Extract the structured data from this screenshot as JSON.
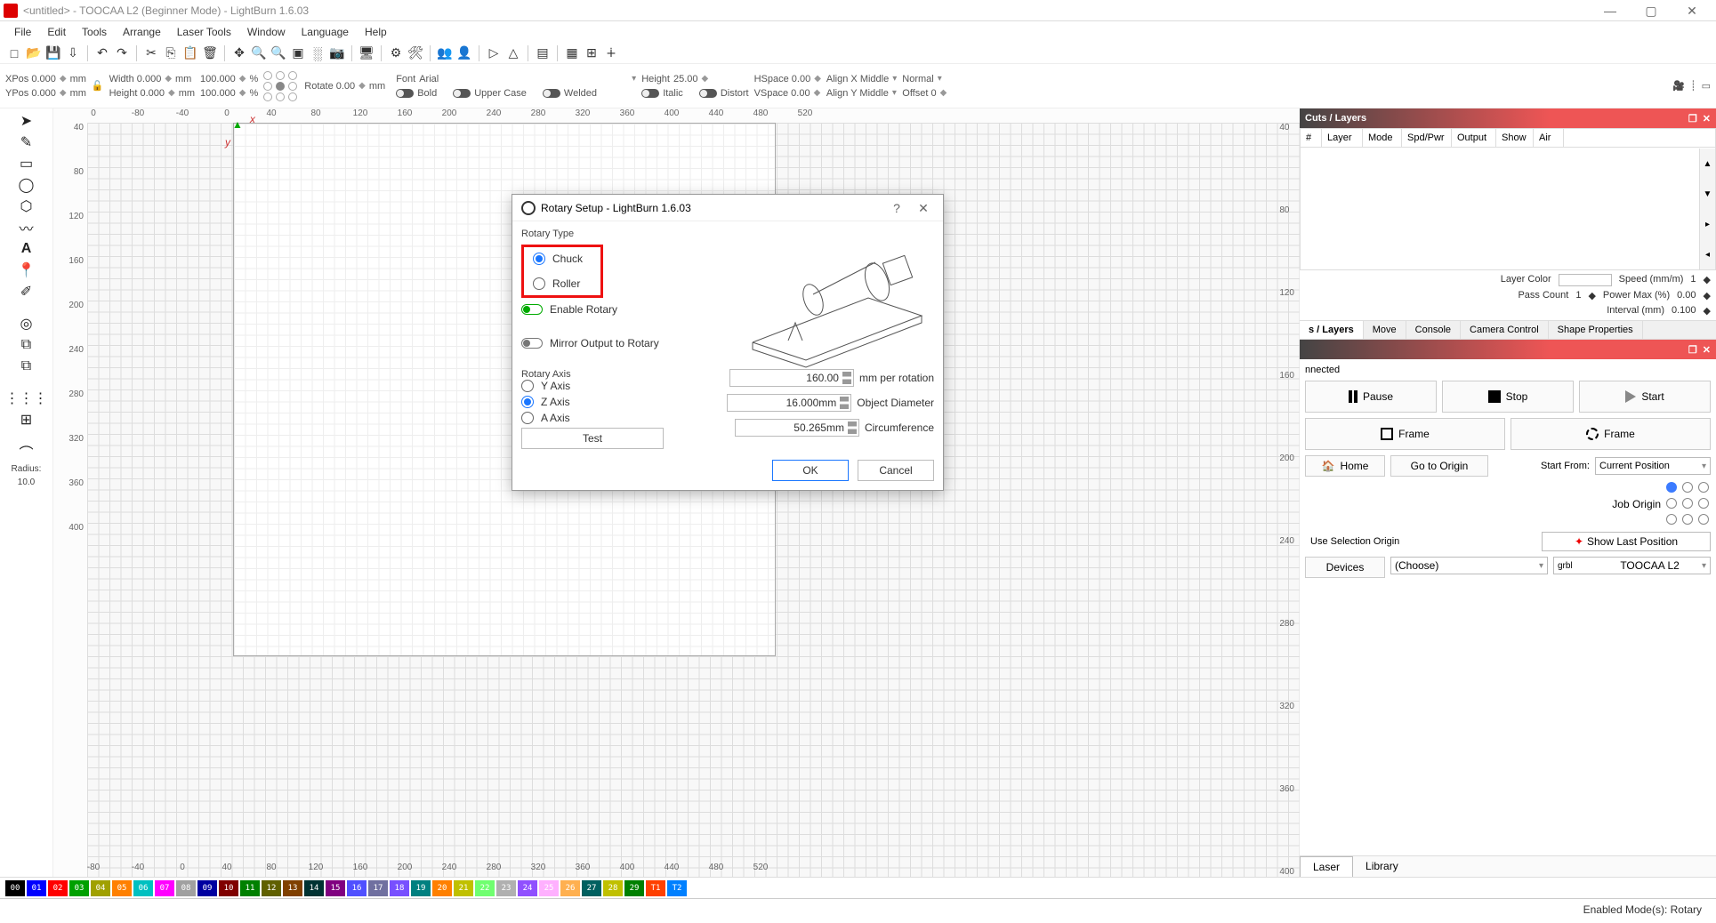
{
  "window": {
    "title": "<untitled> - TOOCAA L2 (Beginner Mode) - LightBurn 1.6.03",
    "min_icon": "—",
    "max_icon": "▢",
    "close_icon": "✕"
  },
  "menubar": [
    "File",
    "Edit",
    "Tools",
    "Arrange",
    "Laser Tools",
    "Window",
    "Language",
    "Help"
  ],
  "props": {
    "xpos": "XPos 0.000",
    "ypos": "YPos 0.000",
    "mm1": "mm",
    "width": "Width 0.000",
    "height": "Height 0.000",
    "mm2": "mm",
    "w100": "100.000",
    "h100": "100.000",
    "pct": "%",
    "rotate": "Rotate 0.00",
    "mm3": "mm",
    "font_label": "Font",
    "font_value": "Arial",
    "height_label": "Height",
    "height_value": "25.00",
    "bold": "Bold",
    "italic": "Italic",
    "upper": "Upper Case",
    "distort": "Distort",
    "welded": "Welded",
    "hspace": "HSpace 0.00",
    "vspace": "VSpace 0.00",
    "alignx": "Align X Middle",
    "aligny": "Align Y Middle",
    "normal": "Normal",
    "offset": "Offset 0"
  },
  "left_tools_radius_label": "Radius:",
  "left_tools_radius_value": "10.0",
  "ruler_top": [
    "0",
    "-80",
    "-40",
    "0",
    "40",
    "80",
    "120",
    "160",
    "200",
    "240",
    "280",
    "320",
    "360",
    "400",
    "440",
    "480",
    "520"
  ],
  "ruler_left": [
    "40",
    "80",
    "120",
    "160",
    "200",
    "240",
    "280",
    "320",
    "360",
    "400"
  ],
  "ruler_bottom": [
    "-80",
    "-40",
    "0",
    "40",
    "80",
    "120",
    "160",
    "200",
    "240",
    "280",
    "320",
    "360",
    "400",
    "440",
    "480",
    "520"
  ],
  "ruler_right": [
    "40",
    "80",
    "120",
    "160",
    "200",
    "240",
    "280",
    "320",
    "360",
    "400"
  ],
  "cuts_panel": {
    "title": "Cuts / Layers",
    "cols": [
      "#",
      "Layer",
      "Mode",
      "Spd/Pwr",
      "Output",
      "Show",
      "Air"
    ],
    "layer_color": "Layer Color",
    "speed_label": "Speed (mm/m)",
    "speed_value": "1",
    "pass_count_label": "Pass Count",
    "pass_count_value": "1",
    "power_label": "Power Max (%)",
    "power_value": "0.00",
    "interval_label": "Interval (mm)",
    "interval_value": "0.100"
  },
  "tabs_row": [
    "s / Layers",
    "Move",
    "Console",
    "Camera Control",
    "Shape Properties"
  ],
  "laser_panel": {
    "connected": "nnected",
    "pause": "Pause",
    "stop": "Stop",
    "start": "Start",
    "frame1": "Frame",
    "frame2": "Frame",
    "home": "Home",
    "go_origin": "Go to Origin",
    "start_from": "Start From:",
    "start_from_value": "Current Position",
    "job_origin": "Job Origin",
    "use_sel_origin": "Use Selection Origin",
    "show_last": "Show Last Position",
    "devices": "Devices",
    "choose": "(Choose)",
    "dev_name": "TOOCAA L2"
  },
  "lib_tabs": [
    "Laser",
    "Library"
  ],
  "color_swatches": [
    {
      "lbl": "00",
      "bg": "#000000"
    },
    {
      "lbl": "01",
      "bg": "#0000ff"
    },
    {
      "lbl": "02",
      "bg": "#ff0000"
    },
    {
      "lbl": "03",
      "bg": "#00a000"
    },
    {
      "lbl": "04",
      "bg": "#a0a000"
    },
    {
      "lbl": "05",
      "bg": "#ff8000"
    },
    {
      "lbl": "06",
      "bg": "#00c0c0"
    },
    {
      "lbl": "07",
      "bg": "#ff00ff"
    },
    {
      "lbl": "08",
      "bg": "#a0a0a0"
    },
    {
      "lbl": "09",
      "bg": "#0000a0"
    },
    {
      "lbl": "10",
      "bg": "#800000"
    },
    {
      "lbl": "11",
      "bg": "#008000"
    },
    {
      "lbl": "12",
      "bg": "#606000"
    },
    {
      "lbl": "13",
      "bg": "#804000"
    },
    {
      "lbl": "14",
      "bg": "#003232"
    },
    {
      "lbl": "15",
      "bg": "#800080"
    },
    {
      "lbl": "16",
      "bg": "#5050ff"
    },
    {
      "lbl": "17",
      "bg": "#7070a0"
    },
    {
      "lbl": "18",
      "bg": "#7850ff"
    },
    {
      "lbl": "19",
      "bg": "#008080"
    },
    {
      "lbl": "20",
      "bg": "#ff8000"
    },
    {
      "lbl": "21",
      "bg": "#c0c000"
    },
    {
      "lbl": "22",
      "bg": "#70ff70"
    },
    {
      "lbl": "23",
      "bg": "#b0b0b0"
    },
    {
      "lbl": "24",
      "bg": "#9050ff"
    },
    {
      "lbl": "25",
      "bg": "#ffb0ff"
    },
    {
      "lbl": "26",
      "bg": "#ffb050"
    },
    {
      "lbl": "27",
      "bg": "#006060"
    },
    {
      "lbl": "28",
      "bg": "#c0c000"
    },
    {
      "lbl": "29",
      "bg": "#008000"
    },
    {
      "lbl": "T1",
      "bg": "#ff4000"
    },
    {
      "lbl": "T2",
      "bg": "#0080ff"
    }
  ],
  "status_bar": "Enabled Mode(s): Rotary",
  "rotary": {
    "title": "Rotary Setup - LightBurn 1.6.03",
    "help": "?",
    "close": "✕",
    "rotary_type": "Rotary Type",
    "chuck": "Chuck",
    "roller": "Roller",
    "enable": "Enable Rotary",
    "mirror": "Mirror Output to Rotary",
    "axis_label": "Rotary Axis",
    "y_axis": "Y Axis",
    "z_axis": "Z Axis",
    "a_axis": "A Axis",
    "mm_per_rot_val": "160.00",
    "mm_per_rot_lbl": "mm per rotation",
    "obj_dia_val": "16.000mm",
    "obj_dia_lbl": "Object Diameter",
    "circ_val": "50.265mm",
    "circ_lbl": "Circumference",
    "test": "Test",
    "ok": "OK",
    "cancel": "Cancel"
  }
}
